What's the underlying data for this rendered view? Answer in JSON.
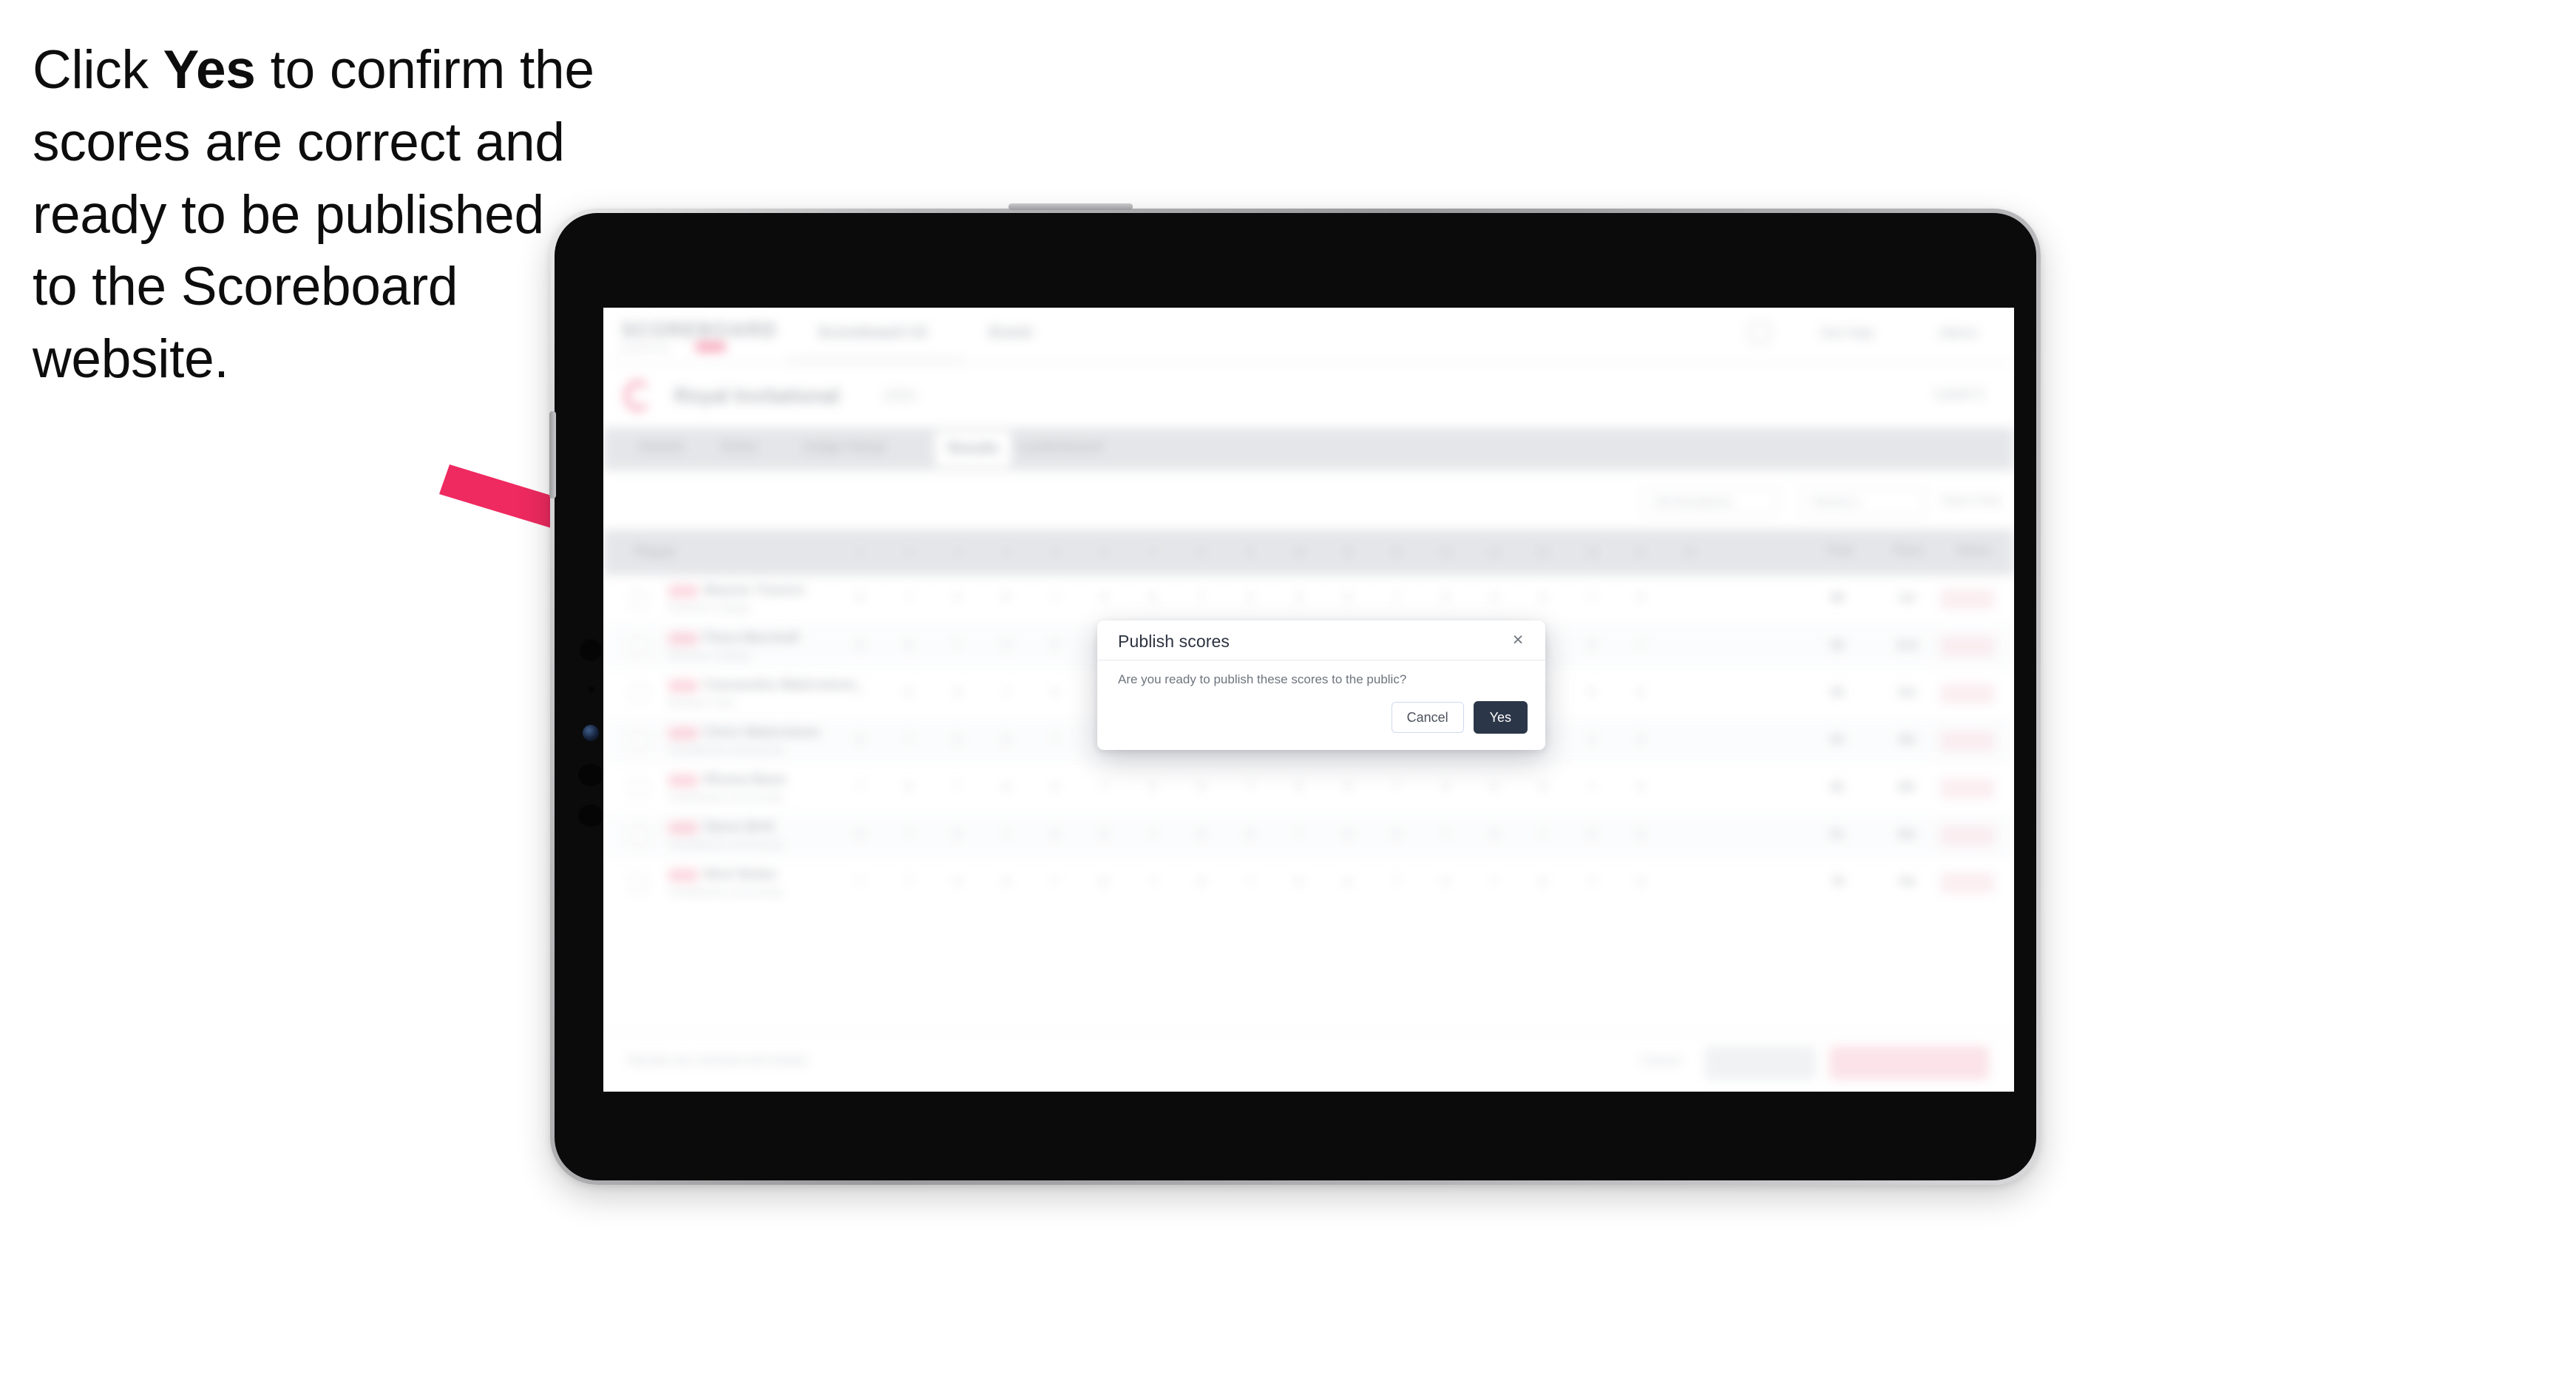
{
  "instruction": {
    "before": "Click ",
    "emphasis": "Yes",
    "after": " to confirm the scores are correct and ready to be published to the Scoreboard website."
  },
  "annotation": {
    "arrow_color": "#ee2a60",
    "arrow_name": "pointer-arrow"
  },
  "device": {
    "type": "tablet",
    "frame_color": "#b6b6b8",
    "body_color": "#0b0b0c"
  },
  "app": {
    "nav": {
      "brand": "SCOREBOARD",
      "brand_sub": "powered by",
      "links": [
        "Scoreboard V2",
        "Event"
      ],
      "right_links": [
        "Get Help",
        "Admin"
      ]
    },
    "event": {
      "name": "Royal Invitational",
      "meta": "2024",
      "right_label": "Level 3"
    },
    "tabs": [
      {
        "label": "Details",
        "active": false
      },
      {
        "label": "Entry",
        "active": false
      },
      {
        "label": "Judge Setup",
        "active": false
      },
      {
        "label": "Results",
        "active": true
      },
      {
        "label": "Leaderboard",
        "active": false
      }
    ],
    "filters": {
      "discipline": "All Disciplines",
      "round": "Round 1",
      "sort": "Team Only"
    },
    "table": {
      "columns": [
        "Player",
        "1",
        "2",
        "3",
        "4",
        "5",
        "6",
        "7",
        "8",
        "9",
        "10",
        "11",
        "12",
        "13",
        "14",
        "15",
        "16",
        "17",
        "18",
        "Total",
        "Place",
        "Status"
      ],
      "rows": [
        {
          "name": "Maxine Travers",
          "club": "Riverton College",
          "scores": [
            "8",
            "7",
            "9",
            "8",
            "7",
            "9",
            "8",
            "7",
            "9",
            "8",
            "9",
            "7",
            "8",
            "9",
            "8",
            "7",
            "9"
          ],
          "total": "88",
          "place": "1st",
          "status": "OK"
        },
        {
          "name": "Flora Marshall",
          "club": "Riverton College",
          "scores": [
            "8",
            "8",
            "7",
            "9",
            "8",
            "8",
            "7",
            "9",
            "8",
            "7",
            "8",
            "9",
            "8",
            "7",
            "8",
            "8",
            "7"
          ],
          "total": "86",
          "place": "2nd",
          "status": "OK"
        },
        {
          "name": "Cassandra Waterstone",
          "club": "Bracken Park",
          "scores": [
            "7",
            "8",
            "8",
            "7",
            "9",
            "8",
            "7",
            "8",
            "9",
            "8",
            "7",
            "8",
            "8",
            "9",
            "7",
            "8",
            "8"
          ],
          "total": "85",
          "place": "3rd",
          "status": "OK"
        },
        {
          "name": "Chris Waterstone",
          "club": "Southlands Community",
          "scores": [
            "8",
            "7",
            "8",
            "8",
            "7",
            "9",
            "8",
            "7",
            "8",
            "8",
            "9",
            "7",
            "8",
            "8",
            "7",
            "9",
            "8"
          ],
          "total": "84",
          "place": "4th",
          "status": "OK"
        },
        {
          "name": "Rhona Bann",
          "club": "Southlands Community",
          "scores": [
            "7",
            "8",
            "7",
            "8",
            "8",
            "7",
            "9",
            "8",
            "7",
            "8",
            "8",
            "7",
            "9",
            "8",
            "8",
            "7",
            "8"
          ],
          "total": "82",
          "place": "5th",
          "status": "OK"
        },
        {
          "name": "Steve Britt",
          "club": "Southlands Community",
          "scores": [
            "8",
            "7",
            "8",
            "7",
            "8",
            "8",
            "7",
            "8",
            "8",
            "7",
            "8",
            "8",
            "7",
            "8",
            "7",
            "8",
            "8"
          ],
          "total": "81",
          "place": "6th",
          "status": "OK"
        },
        {
          "name": "Nick Nolan",
          "club": "Southlands Community",
          "scores": [
            "7",
            "7",
            "8",
            "8",
            "7",
            "8",
            "7",
            "8",
            "7",
            "8",
            "8",
            "7",
            "8",
            "7",
            "8",
            "7",
            "8"
          ],
          "total": "79",
          "place": "7th",
          "status": "OK"
        }
      ]
    },
    "footer": {
      "note": "Results are checked and locked",
      "link": "Cancel",
      "secondary_button": "Save",
      "primary_button": "Publish to Scoreboard"
    }
  },
  "modal": {
    "title": "Publish scores",
    "close_icon": "×",
    "body": "Are you ready to publish these scores to the public?",
    "cancel_label": "Cancel",
    "confirm_label": "Yes",
    "confirm_bg": "#2b3648"
  }
}
